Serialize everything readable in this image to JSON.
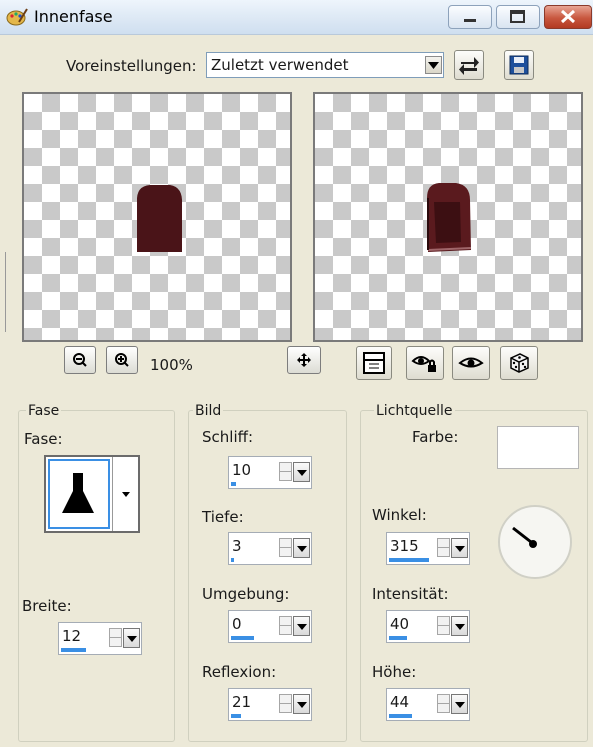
{
  "window": {
    "title": "Innenfase"
  },
  "presets": {
    "label": "Voreinstellungen:",
    "value": "Zuletzt verwendet"
  },
  "zoom": {
    "value": "100%"
  },
  "groups": {
    "fase": {
      "title": "Fase",
      "bevel_label": "Fase:",
      "width_label": "Breite:",
      "width_value": "12",
      "width_fraction": 0.55
    },
    "bild": {
      "title": "Bild",
      "smoothness_label": "Schliff:",
      "smoothness_value": "10",
      "smoothness_fraction": 0.1,
      "depth_label": "Tiefe:",
      "depth_value": "3",
      "depth_fraction": 0.02,
      "ambience_label": "Umgebung:",
      "ambience_value": "0",
      "ambience_fraction": 0.5,
      "shininess_label": "Reflexion:",
      "shininess_value": "21",
      "shininess_fraction": 0.21
    },
    "light": {
      "title": "Lichtquelle",
      "color_label": "Farbe:",
      "angle_label": "Winkel:",
      "angle_value": "315",
      "angle_fraction": 0.875,
      "intensity_label": "Intensität:",
      "intensity_value": "40",
      "intensity_fraction": 0.4,
      "elevation_label": "Höhe:",
      "elevation_value": "44",
      "elevation_fraction": 0.49
    }
  },
  "colors": {
    "accent": "#3a8fe4",
    "shape": "#4a1418",
    "window_bg": "#ece9d8"
  }
}
